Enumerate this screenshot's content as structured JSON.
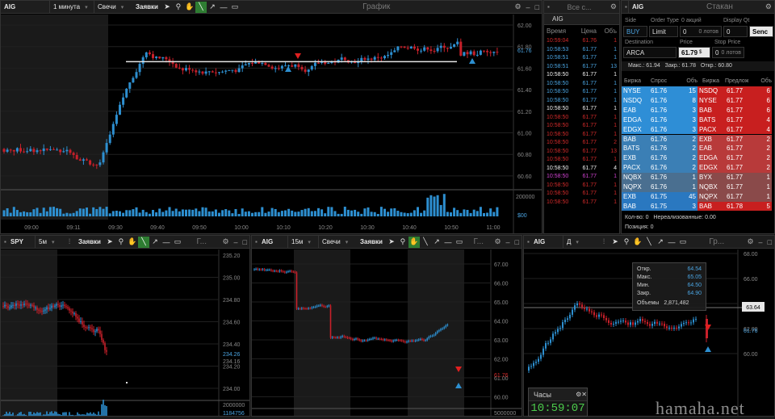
{
  "main_chart": {
    "symbol": "AIG",
    "interval": "1 минута",
    "type": "Свечи",
    "orders_label": "Заявки",
    "title": "График",
    "price_ticks": [
      "62.00",
      "61.80",
      "61.60",
      "61.40",
      "61.20",
      "61.00",
      "60.80",
      "60.60"
    ],
    "current_price": "61.76",
    "volume_ticks": [
      "200000",
      "$00"
    ],
    "time_ticks": [
      "09:00",
      "09:11",
      "09:30",
      "09:40",
      "09:50",
      "10:00",
      "10:10",
      "10:20",
      "10:30",
      "10:40",
      "10:50",
      "11:00"
    ]
  },
  "tape": {
    "title": "Все с...",
    "symbol": "AIG",
    "headers": [
      "Время",
      "Цена",
      "Объ"
    ],
    "rows": [
      {
        "t": "10:59:04",
        "p": "61.76",
        "q": "1",
        "c": "dn"
      },
      {
        "t": "10:58:53",
        "p": "61.77",
        "q": "1",
        "c": "up"
      },
      {
        "t": "10:58:51",
        "p": "61.77",
        "q": "1",
        "c": "up"
      },
      {
        "t": "10:58:51",
        "p": "61.77",
        "q": "13",
        "c": "up"
      },
      {
        "t": "10:58:50",
        "p": "61.77",
        "q": "1",
        "c": "wh"
      },
      {
        "t": "10:58:50",
        "p": "61.77",
        "q": "1",
        "c": "up"
      },
      {
        "t": "10:58:50",
        "p": "61.77",
        "q": "1",
        "c": "up"
      },
      {
        "t": "10:58:50",
        "p": "61.77",
        "q": "1",
        "c": "up"
      },
      {
        "t": "10:58:50",
        "p": "61.77",
        "q": "1",
        "c": "wh"
      },
      {
        "t": "10:58:50",
        "p": "61.77",
        "q": "1",
        "c": "dn"
      },
      {
        "t": "10:58:50",
        "p": "61.77",
        "q": "1",
        "c": "dn"
      },
      {
        "t": "10:58:50",
        "p": "61.77",
        "q": "1",
        "c": "dn"
      },
      {
        "t": "10:58:50",
        "p": "61.77",
        "q": "2",
        "c": "dn"
      },
      {
        "t": "10:58:50",
        "p": "61.77",
        "q": "13",
        "c": "dn"
      },
      {
        "t": "10:58:50",
        "p": "61.77",
        "q": "1",
        "c": "dn"
      },
      {
        "t": "10:58:50",
        "p": "61.77",
        "q": "4",
        "c": "wh"
      },
      {
        "t": "10:58:50",
        "p": "61.77",
        "q": "1",
        "c": "mg"
      },
      {
        "t": "10:58:50",
        "p": "61.77",
        "q": "1",
        "c": "dn"
      },
      {
        "t": "10:58:50",
        "p": "61.77",
        "q": "1",
        "c": "dn"
      },
      {
        "t": "10:58:50",
        "p": "61.77",
        "q": "1",
        "c": "dn"
      }
    ]
  },
  "book": {
    "symbol": "AIG",
    "title": "Стакан",
    "side_label": "Side",
    "side": "BUY",
    "order_type_label": "Order Type",
    "order_type": "Limit",
    "qty_label": "0 акций",
    "qty": "0",
    "display_label": "Display Qt",
    "display": "0",
    "lots1": "0 лотов",
    "lots2": "0 лотов",
    "send": "Senc",
    "dest_label": "Destination",
    "dest": "ARCA",
    "price_label": "Price",
    "price": "61.79",
    "currency": "$",
    "stop_label": "Stop Price",
    "stop": "0",
    "stats": "Макс.: 61.94   Закр.: 61.78   Откр.: 60.80",
    "headers": [
      "Биржа",
      "Спрос",
      "Объ",
      "Биржа",
      "Предлож",
      "Объ"
    ],
    "bids": [
      [
        "NYSE",
        "61.76",
        "15"
      ],
      [
        "NSDQ",
        "61.76",
        "8"
      ],
      [
        "EAB",
        "61.76",
        "3"
      ],
      [
        "EDGA",
        "61.76",
        "3"
      ],
      [
        "EDGX",
        "61.76",
        "3"
      ],
      [
        "BAB",
        "61.76",
        "2"
      ],
      [
        "BATS",
        "61.76",
        "2"
      ],
      [
        "EXB",
        "61.76",
        "2"
      ],
      [
        "PACX",
        "61.76",
        "2"
      ],
      [
        "NQBX",
        "61.76",
        "1"
      ],
      [
        "NQPX",
        "61.76",
        "1"
      ],
      [
        "EXB",
        "61.75",
        "45"
      ],
      [
        "BAB",
        "61.75",
        "3"
      ],
      [
        "BAB",
        "61.74",
        "6"
      ]
    ],
    "asks": [
      [
        "NSDQ",
        "61.77",
        "6"
      ],
      [
        "NYSE",
        "61.77",
        "6"
      ],
      [
        "BAB",
        "61.77",
        "6"
      ],
      [
        "BATS",
        "61.77",
        "4"
      ],
      [
        "PACX",
        "61.77",
        "4"
      ],
      [
        "EXB",
        "61.77",
        "2"
      ],
      [
        "EAB",
        "61.77",
        "2"
      ],
      [
        "EDGA",
        "61.77",
        "2"
      ],
      [
        "EDGX",
        "61.77",
        "2"
      ],
      [
        "BYX",
        "61.77",
        "1"
      ],
      [
        "NQBX",
        "61.77",
        "1"
      ],
      [
        "NQPX",
        "61.77",
        "1"
      ],
      [
        "BAB",
        "61.78",
        "5"
      ],
      [
        "EAB",
        "61.78",
        "3"
      ]
    ],
    "footer1": "Кол-во: 0   Нереализованные: 0.00",
    "footer2": "Позиция: 0"
  },
  "spy": {
    "symbol": "SPY",
    "interval": "5м",
    "orders": "Заявки",
    "ticks": [
      "235.20",
      "235.00",
      "234.80",
      "234.60",
      "234.40",
      "234.20",
      "234.00"
    ],
    "tag1": "234.26",
    "tag2": "234.16",
    "vol1": "2000000",
    "vol2": "1184756"
  },
  "aig15": {
    "symbol": "AIG",
    "interval": "15м",
    "type": "Свечи",
    "orders": "Заявки",
    "ticks": [
      "67.00",
      "66.00",
      "65.00",
      "64.00",
      "63.00",
      "62.00",
      "61.00",
      "60.00"
    ],
    "tag1": "61.76",
    "vol": "5000000"
  },
  "aigd": {
    "symbol": "AIG",
    "interval": "Д",
    "ticks": [
      "68.00",
      "66.00",
      "64.00",
      "62.00",
      "60.00"
    ],
    "current": "63.64",
    "tag1": "61.76",
    "legend": [
      [
        "Откр.",
        "64.54"
      ],
      [
        "Макс.",
        "65.05"
      ],
      [
        "Мин.",
        "64.50"
      ],
      [
        "Закр.",
        "64.90"
      ]
    ],
    "vol_label": "Объемы",
    "vol_value": "2,871,482"
  },
  "clock": {
    "title": "Часы",
    "time": "10:59:07"
  },
  "watermark": "hamaha.net",
  "colors": {
    "up": "#2d8fd0",
    "down": "#c8202a",
    "bg": "#000000",
    "accent": "#2e7d32"
  }
}
